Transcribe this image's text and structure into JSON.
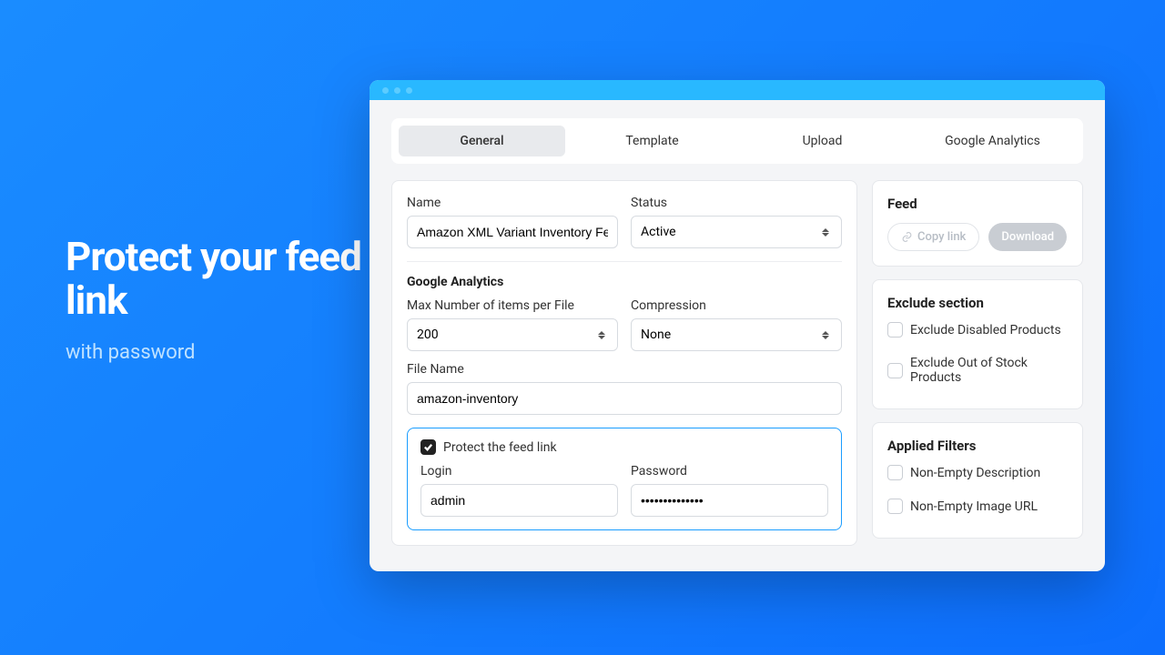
{
  "hero": {
    "title": "Protect your feed link",
    "subtitle": "with password"
  },
  "tabs": [
    {
      "label": "General",
      "active": true
    },
    {
      "label": "Template",
      "active": false
    },
    {
      "label": "Upload",
      "active": false
    },
    {
      "label": "Google Analytics",
      "active": false
    }
  ],
  "form": {
    "name_label": "Name",
    "name_value": "Amazon XML Variant Inventory Feed",
    "status_label": "Status",
    "status_value": "Active",
    "ga_heading": "Google Analytics",
    "max_items_label": "Max Number of items per File",
    "max_items_value": "200",
    "compression_label": "Compression",
    "compression_value": "None",
    "file_name_label": "File Name",
    "file_name_value": "amazon-inventory",
    "protect_label": "Protect the feed link",
    "protect_checked": true,
    "login_label": "Login",
    "login_value": "admin",
    "password_label": "Password",
    "password_value": "••••••••••••••"
  },
  "side": {
    "feed_title": "Feed",
    "copy_label": "Copy link",
    "download_label": "Download",
    "exclude_title": "Exclude section",
    "exclude_items": [
      {
        "label": "Exclude Disabled Products",
        "checked": false
      },
      {
        "label": "Exclude Out of Stock Products",
        "checked": false
      }
    ],
    "filters_title": "Applied Filters",
    "filters_items": [
      {
        "label": "Non-Empty Description",
        "checked": false
      },
      {
        "label": "Non-Empty Image URL",
        "checked": false
      }
    ]
  }
}
